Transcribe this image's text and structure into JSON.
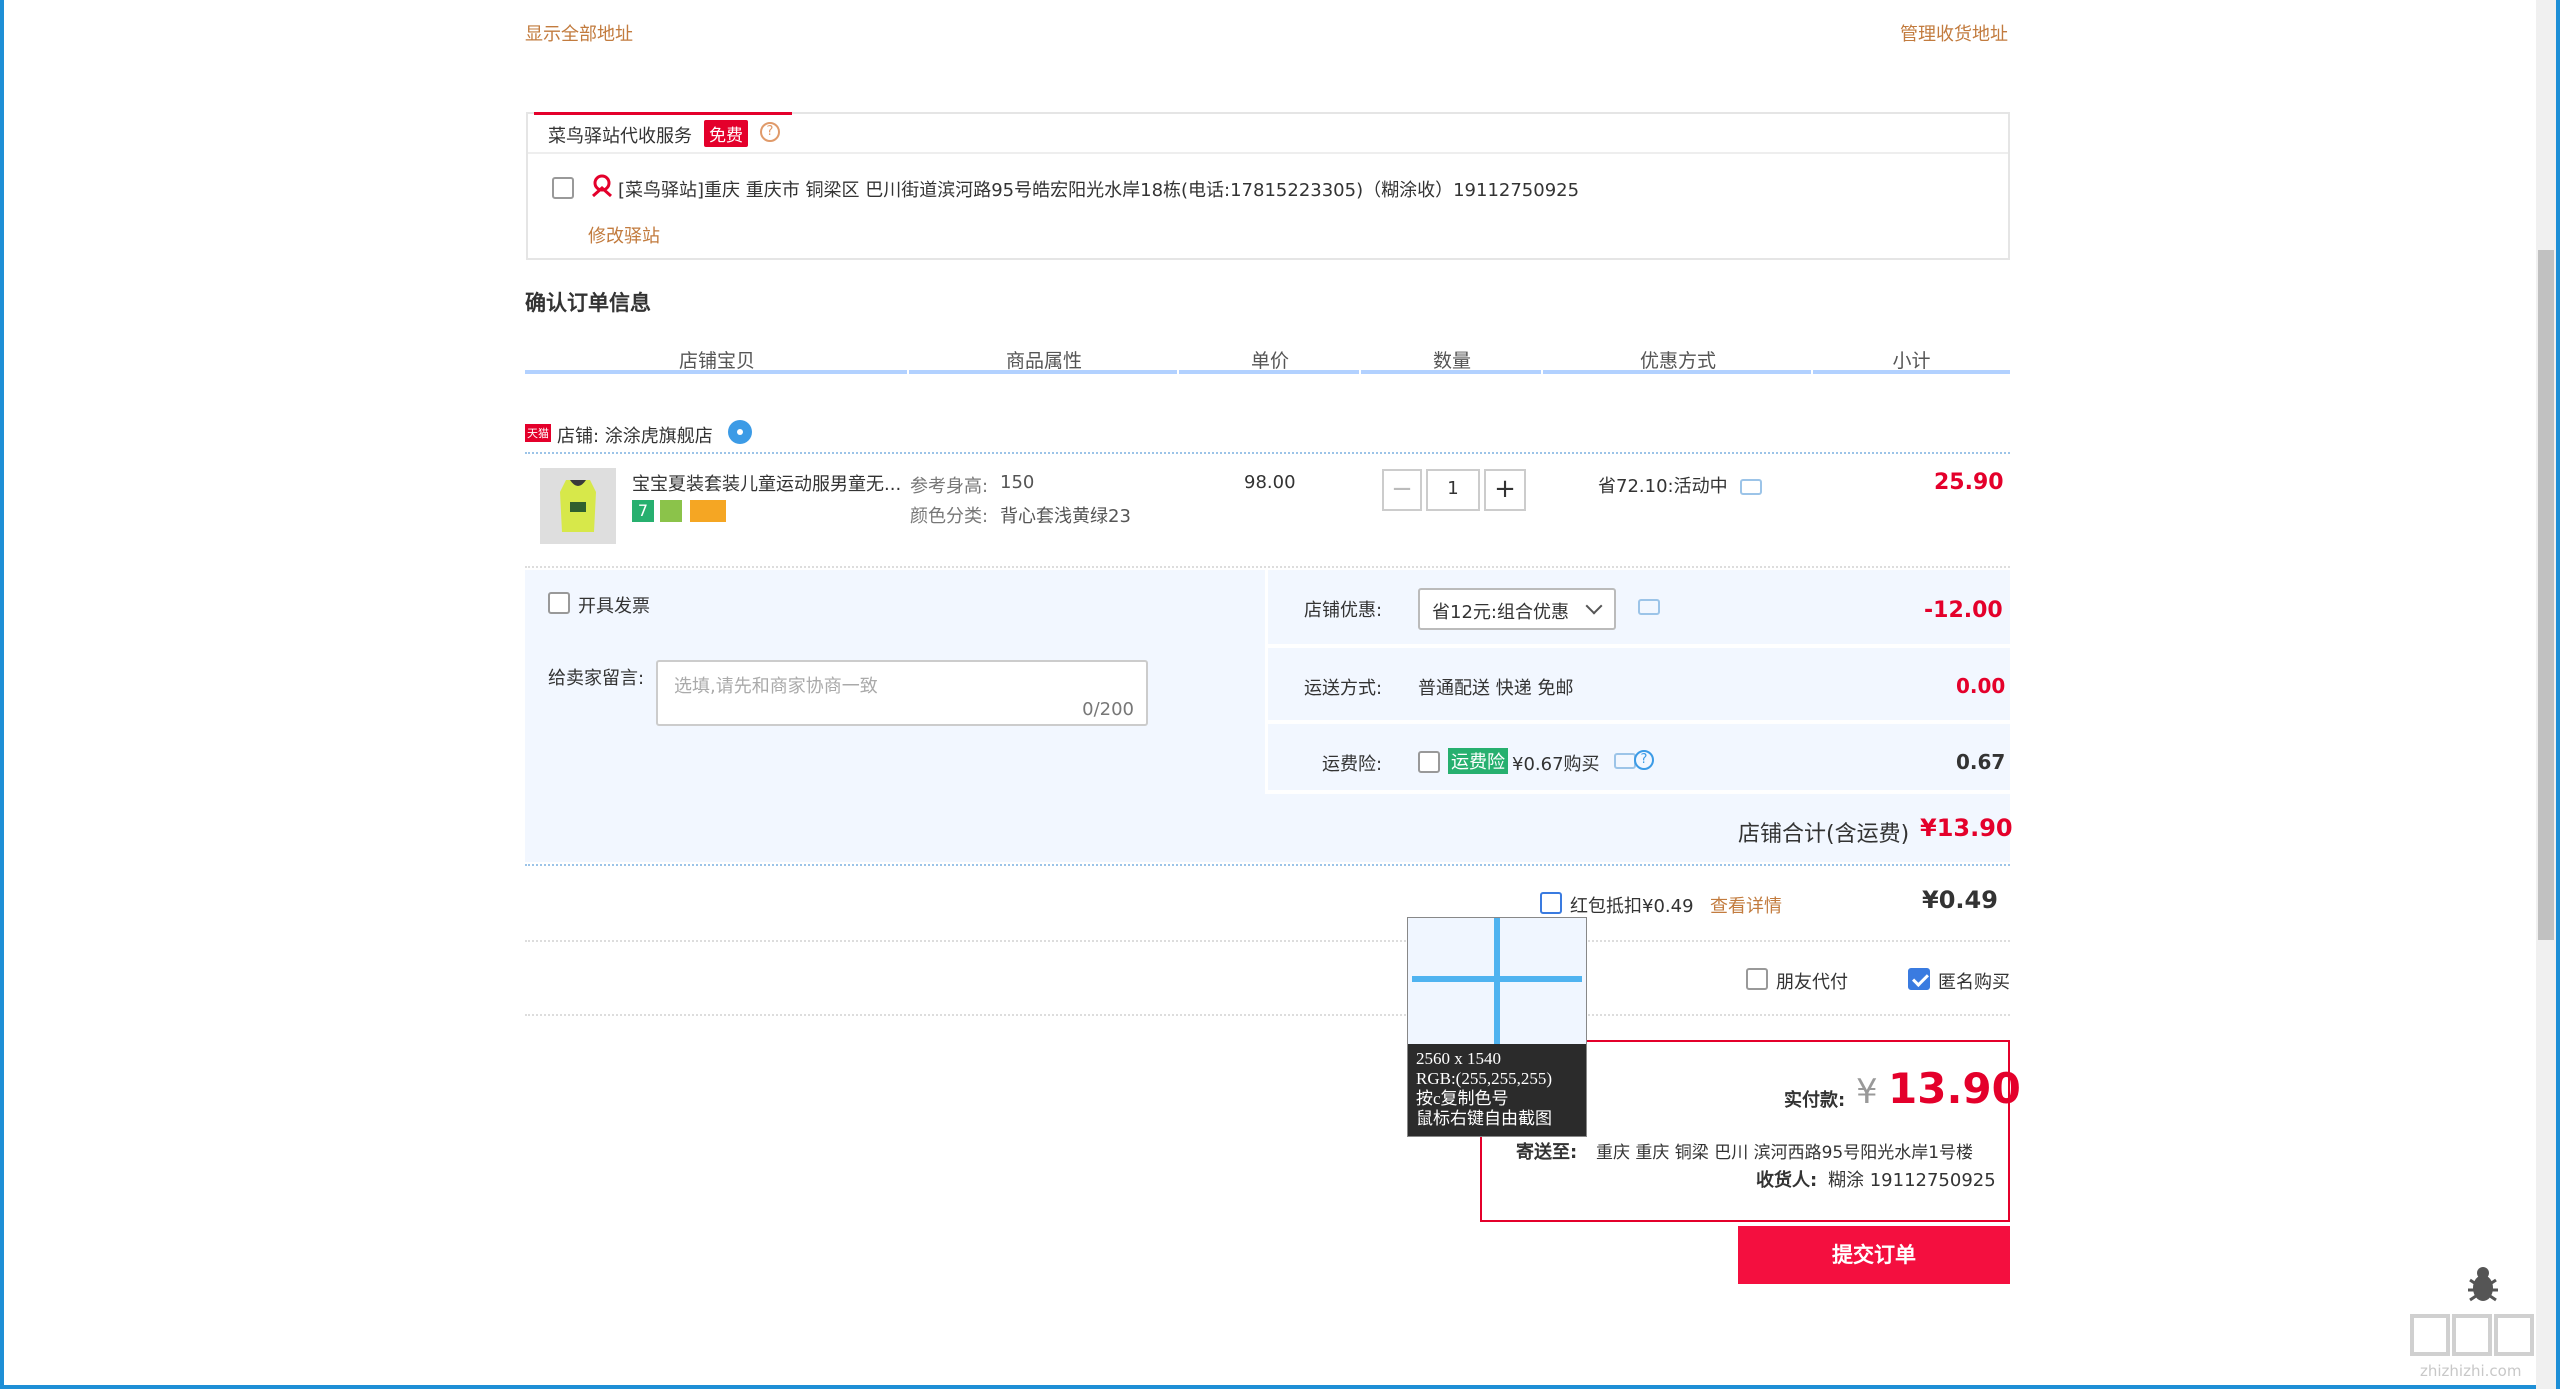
{
  "address": {
    "show_all_label": "显示全部地址",
    "manage_label": "管理收货地址"
  },
  "cainiao": {
    "tab_title": "菜鸟驿站代收服务",
    "free_badge": "免费",
    "station_text": "[菜鸟驿站]重庆 重庆市 铜梁区 巴川街道滨河路95号皓宏阳光水岸18栋(电话:17815223305)（糊涂收）19112750925",
    "edit_label": "修改驿站"
  },
  "order": {
    "section_title": "确认订单信息",
    "columns": [
      "店铺宝贝",
      "商品属性",
      "单价",
      "数量",
      "优惠方式",
      "小计"
    ]
  },
  "shop": {
    "badge": "天猫",
    "name": "店铺: 涂涂虎旗舰店"
  },
  "item": {
    "title": "宝宝夏装套装儿童运动服男童无...",
    "attr1_label": "参考身高:",
    "attr1_value": "150",
    "attr2_label": "颜色分类:",
    "attr2_value": "背心套浅黄绿23",
    "price": "98.00",
    "quantity": "1",
    "discount": "省72.10:活动中",
    "subtotal": "25.90"
  },
  "extras": {
    "invoice_label": "开具发票",
    "message_label": "给卖家留言:",
    "message_placeholder": "选填,请先和商家协商一致",
    "message_count": "0/200",
    "shop_discount_label": "店铺优惠:",
    "shop_discount_value": "省12元:组合优惠",
    "shop_discount_amount": "-12.00",
    "shipping_label": "运送方式:",
    "shipping_value": "普通配送 快递 免邮",
    "shipping_amount": "0.00",
    "insurance_label": "运费险:",
    "insurance_badge": "运费险",
    "insurance_text": "¥0.67购买",
    "insurance_amount": "0.67",
    "shop_total_label": "店铺合计(含运费)",
    "shop_total_value": "¥13.90"
  },
  "redpacket": {
    "label": "红包抵扣¥0.49",
    "details_label": "查看详情",
    "amount": "¥0.49"
  },
  "options": {
    "friend_pay_label": "朋友代付",
    "anonymous_label": "匿名购买"
  },
  "summary": {
    "paid_label": "实付款:",
    "currency": "¥",
    "paid_value": "13.90",
    "ship_to_label": "寄送至:",
    "ship_to_value": "重庆 重庆 铜梁 巴川 滨河西路95号阳光水岸1号楼",
    "receiver_label": "收货人:",
    "receiver_value": "糊涂 19112750925",
    "submit_label": "提交订单"
  },
  "tooltip": {
    "line1": "2560 x 1540",
    "line2": "RGB:(255,255,255)",
    "line3": "按c复制色号",
    "line4": "鼠标右键自由截图"
  },
  "watermark": {
    "text": "zhizhizhi.com"
  },
  "colors": {
    "accent_red": "#e4002b",
    "link_orange": "#c27b3e",
    "panel_blue": "#f2f7ff",
    "frame_blue": "#1e8fd6"
  }
}
